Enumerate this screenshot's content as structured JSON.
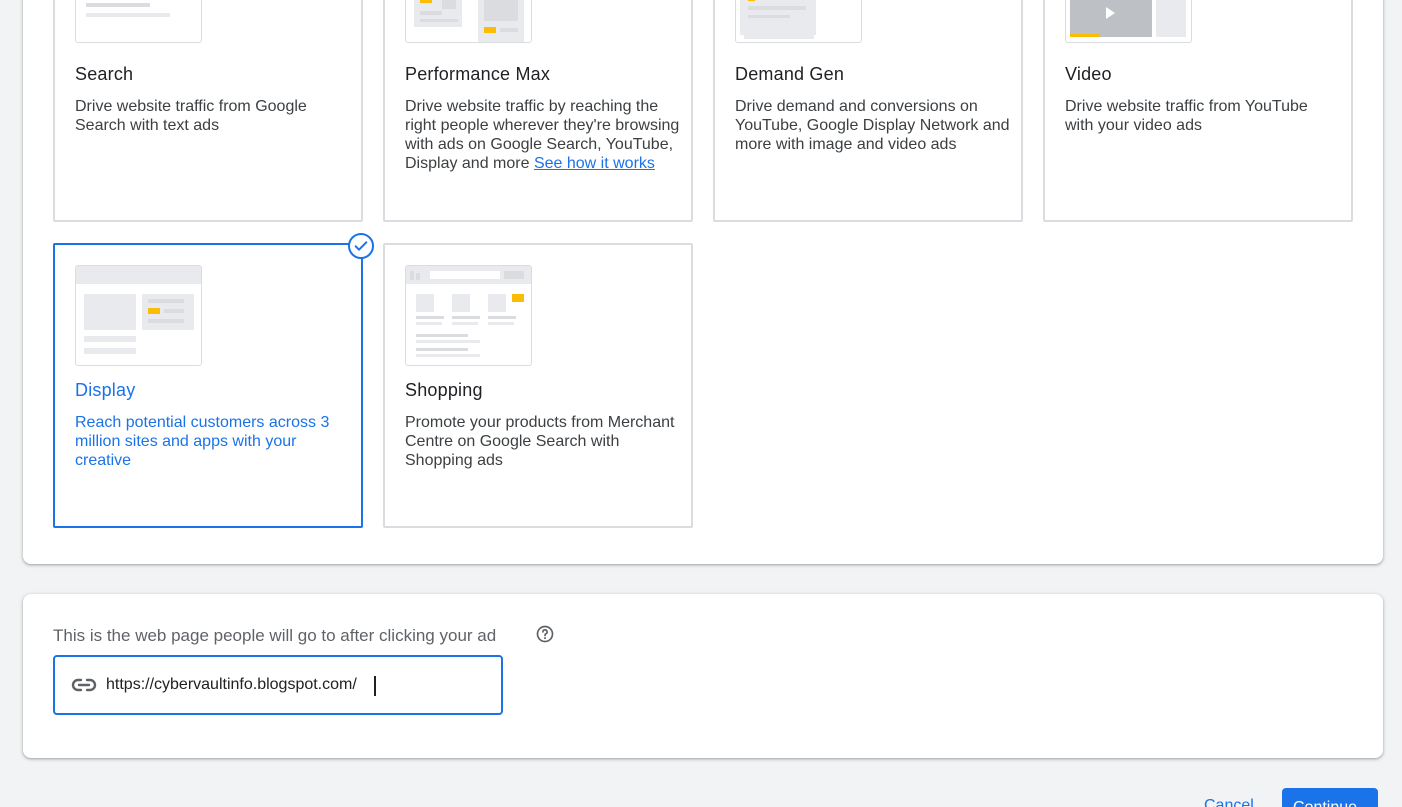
{
  "campaign_types": [
    {
      "id": "search",
      "name": "Search",
      "description": "Drive website traffic from Google Search with text ads",
      "selected": false
    },
    {
      "id": "performance-max",
      "name": "Performance Max",
      "description": "Drive website traffic by reaching the right people wherever they're browsing with ads on Google Search, YouTube, Display and more ",
      "link": "See how it works",
      "selected": false
    },
    {
      "id": "demand-gen",
      "name": "Demand Gen",
      "description": "Drive demand and conversions on YouTube, Google Display Network and more with image and video ads",
      "selected": false
    },
    {
      "id": "video",
      "name": "Video",
      "description": "Drive website traffic from YouTube with your video ads",
      "selected": false
    },
    {
      "id": "display",
      "name": "Display",
      "description": "Reach potential customers across 3 million sites and apps with your creative",
      "selected": true
    },
    {
      "id": "shopping",
      "name": "Shopping",
      "description": "Promote your products from Merchant Centre on Google Search with Shopping ads",
      "selected": false
    }
  ],
  "landing_page": {
    "label": "This is the web page people will go to after clicking your ad",
    "value": "https://cybervaultinfo.blogspot.com/",
    "help_icon": "help-circle-icon",
    "field_icon": "link-icon"
  },
  "footer": {
    "cancel_label": "Cancel",
    "continue_label": "Continue"
  },
  "colors": {
    "accent": "#1a73e8",
    "background": "#f1f3f4",
    "highlight": "#fbbc04"
  }
}
